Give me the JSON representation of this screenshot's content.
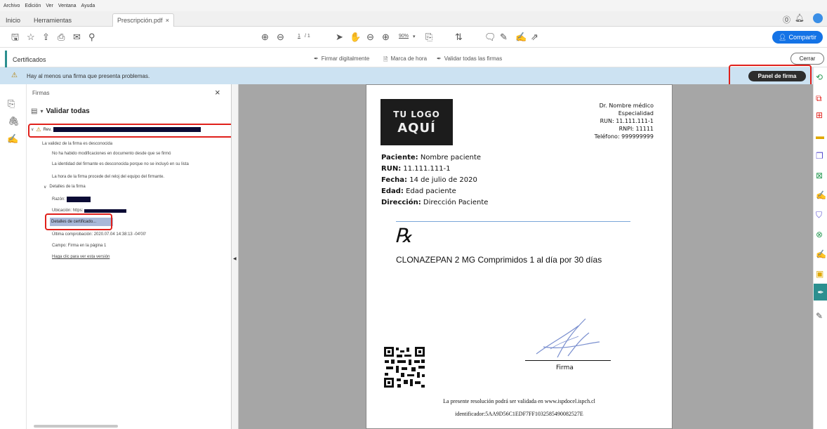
{
  "menu": {
    "items": [
      "Archivo",
      "Edición",
      "Ver",
      "Ventana",
      "Ayuda"
    ]
  },
  "tabs": {
    "home": "Inicio",
    "tools": "Herramientas",
    "doc": "Prescripción.pdf",
    "close": "×"
  },
  "toolbar": {
    "page_current": "1",
    "page_total": "/ 1",
    "zoom": "90%",
    "share": "Compartir"
  },
  "cert_bar": {
    "title": "Certificados",
    "sign_digitally": "Firmar digitalmente",
    "timestamp": "Marca de hora",
    "validate_all": "Validar todas las firmas",
    "close": "Cerrar"
  },
  "warning": {
    "text": "Hay al menos una firma que presenta problemas.",
    "panel_button": "Panel de firma",
    "annotation": "1"
  },
  "panel": {
    "title": "Firmas",
    "close": "×",
    "validate_all": "Validar todas",
    "sig_name": "Rev.",
    "validity": "La validez de la firma es desconocida",
    "no_mods": "No ha habido modificaciones en documento desde que se firmó",
    "identity": "La identidad del firmante es desconocida porque no se incluyó en su lista",
    "time_src": "La hora de la firma procede del reloj del equipo del firmante.",
    "details": "Detalles de la firma",
    "reason": "Razón:",
    "location": "Ubicación: https:",
    "cert_details": "Detalles de certificado...",
    "last_check": "Última comprobación: 2020.07.04 14:38:13 -04'00'",
    "field": "Campo: Firma en la página 1",
    "click_version": "Haga clic para ver esta versión"
  },
  "doc": {
    "logo_top": "TU LOGO",
    "logo_bottom": "AQUÍ",
    "doctor": "Dr. Nombre médico",
    "specialty": "Especialidad",
    "run_doc": "RUN: 11.111.111-1",
    "rnpi": "RNPI: 11111",
    "phone": "Teléfono: 999999999",
    "patient_label": "Paciente:",
    "patient_value": "Nombre paciente",
    "run_label": "RUN:",
    "run_value": "11.111.111-1",
    "date_label": "Fecha:",
    "date_value": "14 de julio de 2020",
    "age_label": "Edad:",
    "age_value": "Edad paciente",
    "address_label": "Dirección:",
    "address_value": "Dirección Paciente",
    "rx": "℞",
    "prescription": "CLONAZEPAN 2 MG Comprimidos  1 al día por 30 días",
    "signature_label": "Firma",
    "footer1": "La presente resolución podrá ser validada en www.ispdocel.ispch.cl",
    "footer2": "identificador:5AA9D56C1EDF7FF1032585490082527E"
  }
}
